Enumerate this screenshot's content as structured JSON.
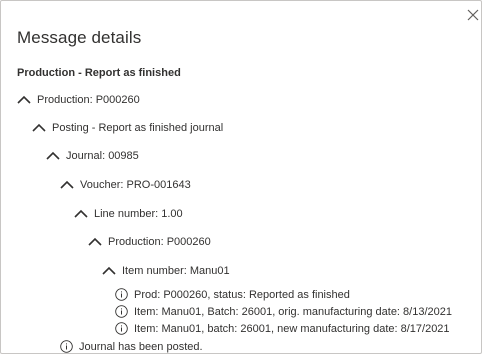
{
  "dialog": {
    "title": "Message details",
    "subtitle": "Production - Report as finished",
    "close_icon": "close-icon"
  },
  "tree": {
    "n0": "Production: P000260",
    "n1": "Posting - Report as finished journal",
    "n2": "Journal: 00985",
    "n3": "Voucher: PRO-001643",
    "n4": "Line number: 1.00",
    "n5": "Production: P000260",
    "n6": "Item number: Manu01"
  },
  "messages": {
    "m0": "Prod: P000260, status: Reported as finished",
    "m1": "Item: Manu01, Batch: 26001, orig. manufacturing date: 8/13/2021",
    "m2": "Item: Manu01, batch: 26001, new manufacturing date: 8/17/2021",
    "m3": "Journal has been posted."
  },
  "icons": {
    "expand": "chevron-up-icon",
    "message": "info-icon"
  }
}
